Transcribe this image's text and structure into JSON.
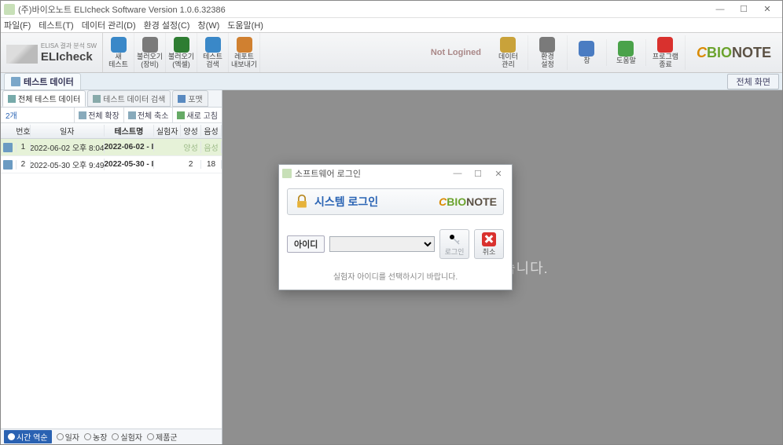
{
  "window": {
    "title": "(주)바이오노트 ELIcheck Software Version 1.0.6.32386",
    "min": "—",
    "max": "☐",
    "close": "✕"
  },
  "menu": [
    "파일(F)",
    "테스트(T)",
    "데이터 관리(D)",
    "환경 설정(C)",
    "창(W)",
    "도움말(H)"
  ],
  "logo": {
    "sub": "ELISA 결과 분석 SW",
    "main": "ELIcheck"
  },
  "ribbon_left": [
    {
      "label": "새\n테스트",
      "color": "#3a88c8"
    },
    {
      "label": "불러오기\n(장비)",
      "color": "#7a7a7a"
    },
    {
      "label": "불러오기\n(엑셀)",
      "color": "#2e7d32"
    },
    {
      "label": "테스트\n검색",
      "color": "#3a88c8"
    },
    {
      "label": "레포트\n내보내기",
      "color": "#d08030"
    }
  ],
  "not_logined": "Not Logined",
  "ribbon_right": [
    {
      "label": "데이터\n관리",
      "color": "#c9a23a"
    },
    {
      "label": "환경\n설정",
      "color": "#7a7a7a"
    },
    {
      "label": "창",
      "color": "#4a7cc2"
    },
    {
      "label": "도움말",
      "color": "#4aa24a"
    },
    {
      "label": "프로그램\n종료",
      "color": "#d9312e"
    }
  ],
  "doctab": {
    "label": "테스트 데이터",
    "fullscreen": "전체 화면"
  },
  "subtabs": [
    {
      "label": "전체 테스트 데이터",
      "active": true
    },
    {
      "label": "테스트 데이터 검색",
      "active": false
    },
    {
      "label": "포맷",
      "active": false
    }
  ],
  "toolbar": {
    "count": "2개",
    "expand": "전체 확장",
    "collapse": "전체 축소",
    "refresh": "새로 고침"
  },
  "headers": {
    "no": "번호",
    "date": "일자",
    "name": "테스트명",
    "exp": "실험자",
    "pos": "양성",
    "neg": "음성"
  },
  "rows": [
    {
      "no": "1",
      "date": "2022-06-02 오후 8:04",
      "name": "2022-06-02 - I",
      "exp": "",
      "pos": "양성",
      "neg": "음성",
      "sel": true
    },
    {
      "no": "2",
      "date": "2022-05-30 오후 9:49",
      "name": "2022-05-30 - I",
      "exp": "",
      "pos": "2",
      "neg": "18",
      "sel": false
    }
  ],
  "filters": {
    "sel": "시간 역순",
    "opts": [
      "일자",
      "농장",
      "실험자",
      "제품군"
    ]
  },
  "nodata": "터가 없습니다.",
  "modal": {
    "title": "소프트웨어 로그인",
    "heading": "시스템 로그인",
    "id_label": "아이디",
    "login": "로그인",
    "cancel": "취소",
    "note": "실험자 아이디를 선택하시기 바랍니다.",
    "min": "—",
    "max": "☐",
    "close": "✕"
  },
  "brand": {
    "c": "C",
    "bio": "BIO",
    "note": "NOTE"
  }
}
